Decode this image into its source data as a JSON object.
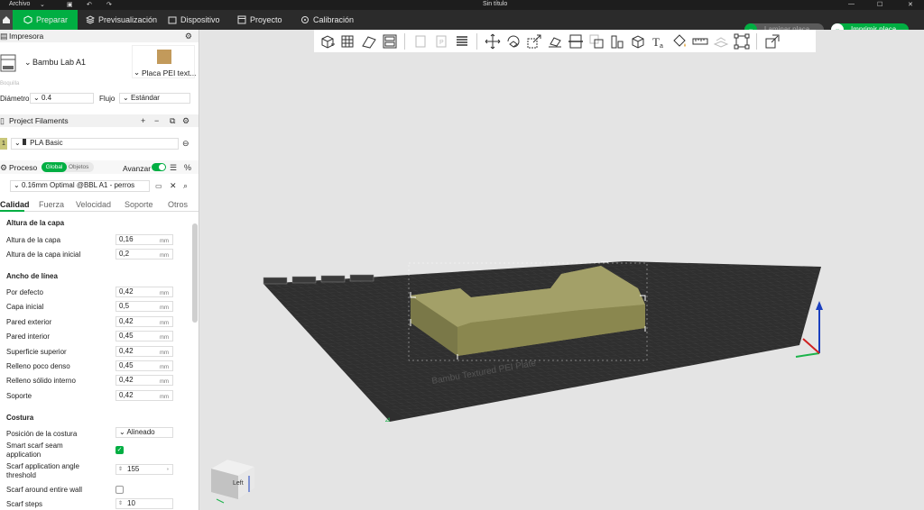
{
  "titlebar": {
    "menu": "Archivo",
    "title": "Sin título"
  },
  "tabs": {
    "prepare": "Preparar",
    "preview": "Previsualización",
    "device": "Dispositivo",
    "project": "Proyecto",
    "calibration": "Calibración"
  },
  "actions": {
    "slice": "Laminar placa",
    "print": "Imprimir placa"
  },
  "printer": {
    "section": "Impresora",
    "name": "Bambu Lab A1",
    "plate": "Placa PEI text...",
    "nozzle_caption": "Boquilla",
    "diameter_label": "Diámetro",
    "diameter_value": "0.4",
    "flow_label": "Flujo",
    "flow_value": "Estándar"
  },
  "filaments": {
    "section": "Project Filaments",
    "slot": "1",
    "name": "PLA Basic",
    "color": "#c9c77a"
  },
  "process": {
    "section": "Proceso",
    "global": "Global",
    "objects": "Objetos",
    "advanced": "Avanzar",
    "profile": "0.16mm Optimal @BBL A1 - perros",
    "tabs": [
      "Calidad",
      "Fuerza",
      "Velocidad",
      "Soporte",
      "Otros"
    ]
  },
  "quality": {
    "layer_height_head": "Altura de la capa",
    "layer_height": {
      "label": "Altura de la capa",
      "value": "0,16",
      "unit": "mm"
    },
    "initial_layer": {
      "label": "Altura de la capa inicial",
      "value": "0,2",
      "unit": "mm"
    },
    "line_width_head": "Ancho de línea",
    "widths": [
      {
        "label": "Por defecto",
        "value": "0,42",
        "unit": "mm"
      },
      {
        "label": "Capa inicial",
        "value": "0,5",
        "unit": "mm"
      },
      {
        "label": "Pared exterior",
        "value": "0,42",
        "unit": "mm"
      },
      {
        "label": "Pared interior",
        "value": "0,45",
        "unit": "mm"
      },
      {
        "label": "Superficie superior",
        "value": "0,42",
        "unit": "mm"
      },
      {
        "label": "Relleno poco denso",
        "value": "0,45",
        "unit": "mm"
      },
      {
        "label": "Relleno sólido interno",
        "value": "0,42",
        "unit": "mm"
      },
      {
        "label": "Soporte",
        "value": "0,42",
        "unit": "mm"
      }
    ],
    "seam_head": "Costura",
    "seam_position": {
      "label": "Posición de la costura",
      "value": "Alineado"
    },
    "smart_scarf": {
      "label1": "Smart scarf seam",
      "label2": "application",
      "checked": true
    },
    "scarf_threshold": {
      "label1": "Scarf application angle",
      "label2": "threshold",
      "value": "155",
      "unit": "°"
    },
    "scarf_wall": {
      "label": "Scarf around entire wall",
      "checked": false
    },
    "scarf_steps": {
      "label": "Scarf steps",
      "value": "10"
    }
  },
  "viewport": {
    "cube_label": "Left",
    "plate_text": "Bambu Textured PEI Plate"
  },
  "colors": {
    "accent": "#00ae42",
    "model": "#a3a068",
    "bed": "#2f2f2f"
  }
}
